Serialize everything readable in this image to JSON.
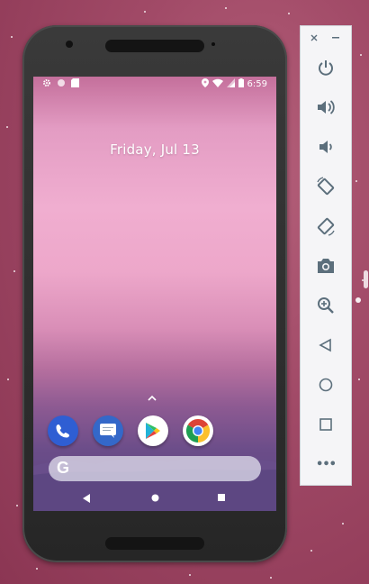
{
  "status_bar": {
    "time": "6:59",
    "left_icons": [
      "settings-icon",
      "circle-icon",
      "sd-card-icon"
    ],
    "right_icons": [
      "location-icon",
      "wifi-icon",
      "cell-signal-icon",
      "battery-icon"
    ]
  },
  "lockscreen": {
    "date": "Friday, Jul 13"
  },
  "dock": [
    {
      "name": "phone-app",
      "icon": "phone-icon",
      "color": "#2f5ed3"
    },
    {
      "name": "messages-app",
      "icon": "messages-icon",
      "color": "#3468c9"
    },
    {
      "name": "play-store-app",
      "icon": "play-store-icon",
      "color": "#ffffff"
    },
    {
      "name": "chrome-app",
      "icon": "chrome-icon",
      "color": "#ffffff"
    }
  ],
  "search": {
    "logo": "G"
  },
  "nav": [
    "back-icon",
    "home-icon",
    "recents-icon"
  ],
  "panel": {
    "controls": [
      "power-icon",
      "volume-up-icon",
      "volume-down-icon",
      "rotate-left-icon",
      "rotate-right-icon",
      "screenshot-icon",
      "zoom-icon",
      "back-icon",
      "home-icon",
      "overview-icon",
      "more-icon"
    ],
    "more_label": "•••",
    "colors": {
      "icon": "#5c6f7c",
      "background": "#f5f5f7"
    }
  },
  "colors": {
    "desktop": "#a14a67",
    "phone_body": "#2e2e2e"
  }
}
